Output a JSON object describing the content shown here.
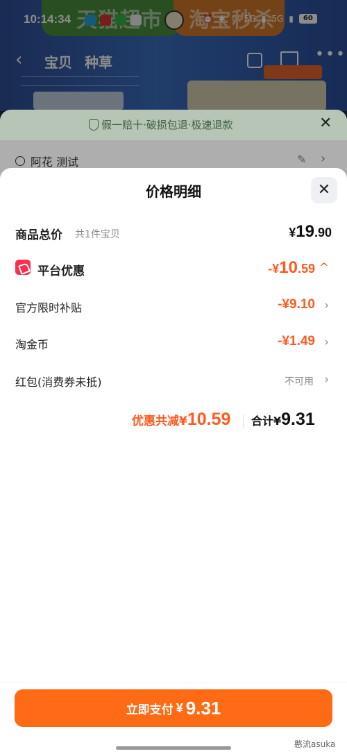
{
  "status_bar": {
    "time": "10:14:34",
    "network_1": "5G",
    "network_2": "5G",
    "battery": "60"
  },
  "background": {
    "banner_left": "天猫超市",
    "banner_right": "淘宝秒杀",
    "nav_tabs": [
      "宝贝",
      "种草"
    ],
    "guarantee_text": "假一赔十·破损包退·极速退款",
    "address_text": "阿花 测试"
  },
  "sheet": {
    "title": "价格明细",
    "goods_total_label": "商品总价",
    "goods_total_sub": "共1件宝贝",
    "goods_total_currency": "¥",
    "goods_total_int": "19",
    "goods_total_dec": ".90",
    "platform_discount_label": "平台优惠",
    "platform_discount_prefix": "-¥",
    "platform_discount_int": "10",
    "platform_discount_dec": ".59",
    "items": [
      {
        "label": "官方限时补贴",
        "value": "-¥9.10"
      },
      {
        "label": "淘金币",
        "value": "-¥1.49"
      },
      {
        "label": "红包(消费券未抵)",
        "value": "不可用"
      }
    ],
    "summary_discount_label": "优惠共减¥",
    "summary_discount_value": "10.59",
    "summary_total_label": "合计¥",
    "summary_total_value": "9.31"
  },
  "bottom": {
    "pay_label": "立即支付",
    "pay_currency": "¥",
    "pay_value": "9.31",
    "watermark": "憨流asuka"
  },
  "colors": {
    "accent": "#ff5a1f",
    "pay_button": "#ff6a14",
    "coupon_icon": "#ff2e4d"
  }
}
